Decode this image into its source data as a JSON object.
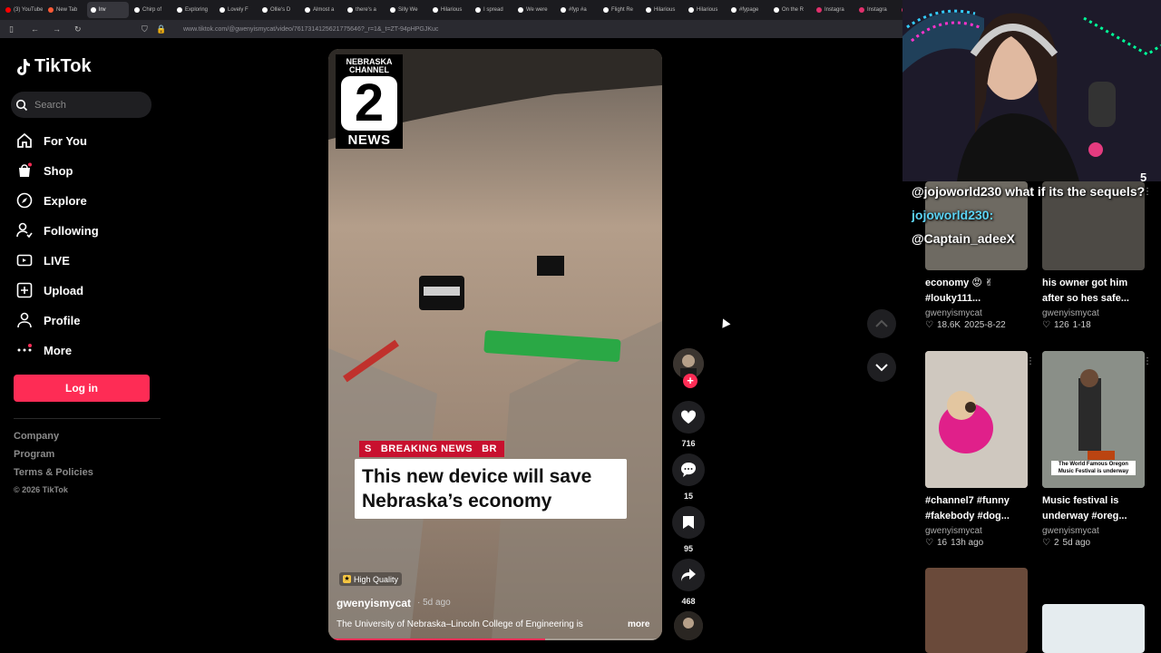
{
  "browser": {
    "tabs": [
      {
        "label": "(3) YouTube",
        "color": "#ff0000"
      },
      {
        "label": "New Tab",
        "color": "#ff5a36"
      },
      {
        "label": "lnv",
        "color": "#ffffff",
        "active": true
      },
      {
        "label": "Chirp of",
        "color": "#ffffff"
      },
      {
        "label": "Exploring",
        "color": "#ffffff"
      },
      {
        "label": "Lovely F",
        "color": "#ffffff"
      },
      {
        "label": "Ollie's D",
        "color": "#ffffff"
      },
      {
        "label": "Almost a",
        "color": "#ffffff"
      },
      {
        "label": "there's a",
        "color": "#ffffff"
      },
      {
        "label": "Silly We",
        "color": "#ffffff"
      },
      {
        "label": "Hilarious",
        "color": "#ffffff"
      },
      {
        "label": "I spread",
        "color": "#ffffff"
      },
      {
        "label": "We were",
        "color": "#ffffff"
      },
      {
        "label": "#fyp #a",
        "color": "#ffffff"
      },
      {
        "label": "Flight Re",
        "color": "#ffffff"
      },
      {
        "label": "Hilarious",
        "color": "#ffffff"
      },
      {
        "label": "Hilarious",
        "color": "#ffffff"
      },
      {
        "label": "#fypage",
        "color": "#ffffff"
      },
      {
        "label": "On the R",
        "color": "#ffffff"
      },
      {
        "label": "Instagra",
        "color": "#e1306c"
      },
      {
        "label": "Instagra",
        "color": "#e1306c"
      },
      {
        "label": "Ins",
        "color": "#e1306c"
      }
    ],
    "url": "www.tiktok.com/@gwenyismycat/video/7617314125621775646?_r=1&_t=ZT-94pHPGJKuc"
  },
  "tiktok": {
    "logo_text": "TikTok",
    "search_placeholder": "Search",
    "nav": [
      {
        "label": "For You",
        "icon": "home-icon"
      },
      {
        "label": "Shop",
        "icon": "shop-icon"
      },
      {
        "label": "Explore",
        "icon": "compass-icon"
      },
      {
        "label": "Following",
        "icon": "following-icon"
      },
      {
        "label": "LIVE",
        "icon": "live-icon"
      },
      {
        "label": "Upload",
        "icon": "upload-icon"
      },
      {
        "label": "Profile",
        "icon": "profile-icon"
      },
      {
        "label": "More",
        "icon": "more-icon"
      }
    ],
    "login_label": "Log in",
    "footer": {
      "company": "Company",
      "program": "Program",
      "terms": "Terms & Policies",
      "copyright": "© 2026 TikTok"
    },
    "accent_color": "#fe2c55"
  },
  "video": {
    "channel_logo": {
      "line1": "NEBRASKA",
      "line2": "CHANNEL",
      "number": "2",
      "line3": "NEWS"
    },
    "breaking_label": "BREAKING NEWS",
    "breaking_left": "S",
    "breaking_right": "BR",
    "headline": "This new device will save Nebraska’s economy",
    "quality_badge": "High Quality",
    "author": "gwenyismycat",
    "time": "· 5d ago",
    "description": "The University of Nebraska–Lincoln College of Engineering is",
    "more_label": "more",
    "progress": 0.65
  },
  "actions": {
    "likes": "716",
    "comments": "15",
    "saves": "95",
    "shares": "468"
  },
  "chat": {
    "line1_user": "@jojoworld230",
    "line1_text": " what if its the sequels?",
    "line2_user": "jojoworld230:",
    "line3_user": "@Captain_adeeX",
    "badge_count": "5"
  },
  "right_cards": [
    {
      "title": "economy 😡 ✌ #louky111...",
      "user": "gwenyismycat",
      "likes": "18.6K",
      "date": "2025-8-22"
    },
    {
      "title": "his owner got him after so hes safe...",
      "user": "gwenyismycat",
      "likes": "126",
      "date": "1-18"
    },
    {
      "title": "#channel7 #funny #fakebody #dog...",
      "user": "gwenyismycat",
      "likes": "16",
      "date": "13h ago"
    },
    {
      "title": "Music festival is underway #oreg...",
      "user": "gwenyismycat",
      "likes": "2",
      "date": "5d ago",
      "overlay": "The World Famous Oregon Music Festival is underway"
    }
  ]
}
